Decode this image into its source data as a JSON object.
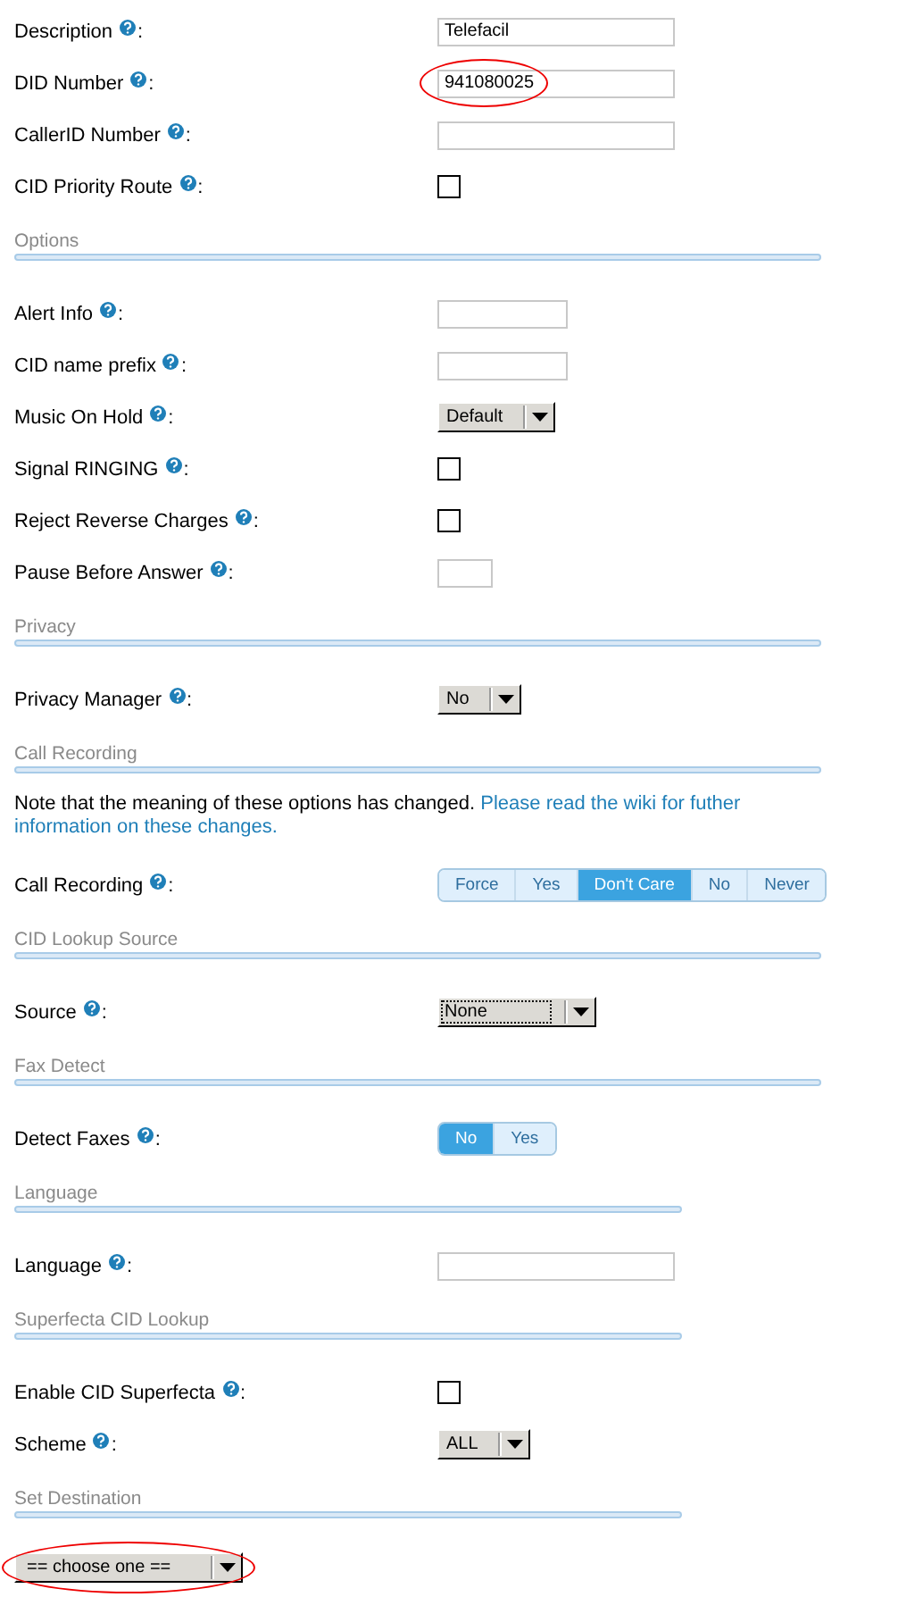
{
  "items": [
    {
      "kind": "text",
      "label": "Description",
      "colon": ":",
      "value": "Telefacil"
    },
    {
      "kind": "text",
      "label": "DID Number",
      "colon": ":",
      "value": "941080025",
      "circled": true
    },
    {
      "kind": "text",
      "label": "CallerID Number",
      "colon": ":"
    },
    {
      "kind": "checkbox",
      "label": "CID Priority Route",
      "colon": ":",
      "checked": false
    },
    {
      "kind": "header",
      "label": "Options"
    },
    {
      "kind": "short-text",
      "label": "Alert Info",
      "colon": ":"
    },
    {
      "kind": "short-text",
      "label": "CID name prefix",
      "colon": ":"
    },
    {
      "kind": "select",
      "label": "Music On Hold",
      "colon": ":",
      "value": "Default"
    },
    {
      "kind": "checkbox",
      "label": "Signal RINGING",
      "colon": ":",
      "checked": false
    },
    {
      "kind": "checkbox",
      "label": "Reject Reverse Charges",
      "colon": ":",
      "checked": false
    },
    {
      "kind": "tiny-text",
      "label": "Pause Before Answer",
      "colon": ":"
    },
    {
      "kind": "header",
      "label": "Privacy"
    },
    {
      "kind": "select",
      "label": "Privacy Manager",
      "colon": ":",
      "value": "No"
    },
    {
      "kind": "header",
      "label": "Call Recording"
    },
    {
      "kind": "note",
      "text": "Note that the meaning of these options has changed.",
      "link": [
        "Please read the wiki for futher",
        "information on these changes."
      ]
    },
    {
      "kind": "segmented",
      "label": "Call Recording",
      "colon": ":",
      "options": [
        {
          "label": "Force",
          "selected": false
        },
        {
          "label": "Yes",
          "selected": false
        },
        {
          "label": "Don't Care",
          "selected": true
        },
        {
          "label": "No",
          "selected": false
        },
        {
          "label": "Never",
          "selected": false
        }
      ]
    },
    {
      "kind": "header",
      "label": "CID Lookup Source"
    },
    {
      "kind": "wide-select",
      "label": "Source",
      "colon": ":",
      "value": "None"
    },
    {
      "kind": "header",
      "label": "Fax Detect"
    },
    {
      "kind": "segmented",
      "label": "Detect Faxes",
      "colon": ":",
      "options": [
        {
          "label": "No",
          "selected": true
        },
        {
          "label": "Yes",
          "selected": false
        }
      ]
    },
    {
      "kind": "short-header",
      "label": "Language"
    },
    {
      "kind": "text",
      "label": "Language",
      "colon": ":"
    },
    {
      "kind": "short-header",
      "label": "Superfecta CID Lookup"
    },
    {
      "kind": "checkbox",
      "label": "Enable CID Superfecta",
      "colon": ":",
      "checked": false
    },
    {
      "kind": "select",
      "label": "Scheme",
      "colon": ":",
      "value": "ALL"
    },
    {
      "kind": "short-header",
      "label": "Set Destination"
    },
    {
      "kind": "destination",
      "value": "== choose one ==",
      "circled": true
    }
  ]
}
